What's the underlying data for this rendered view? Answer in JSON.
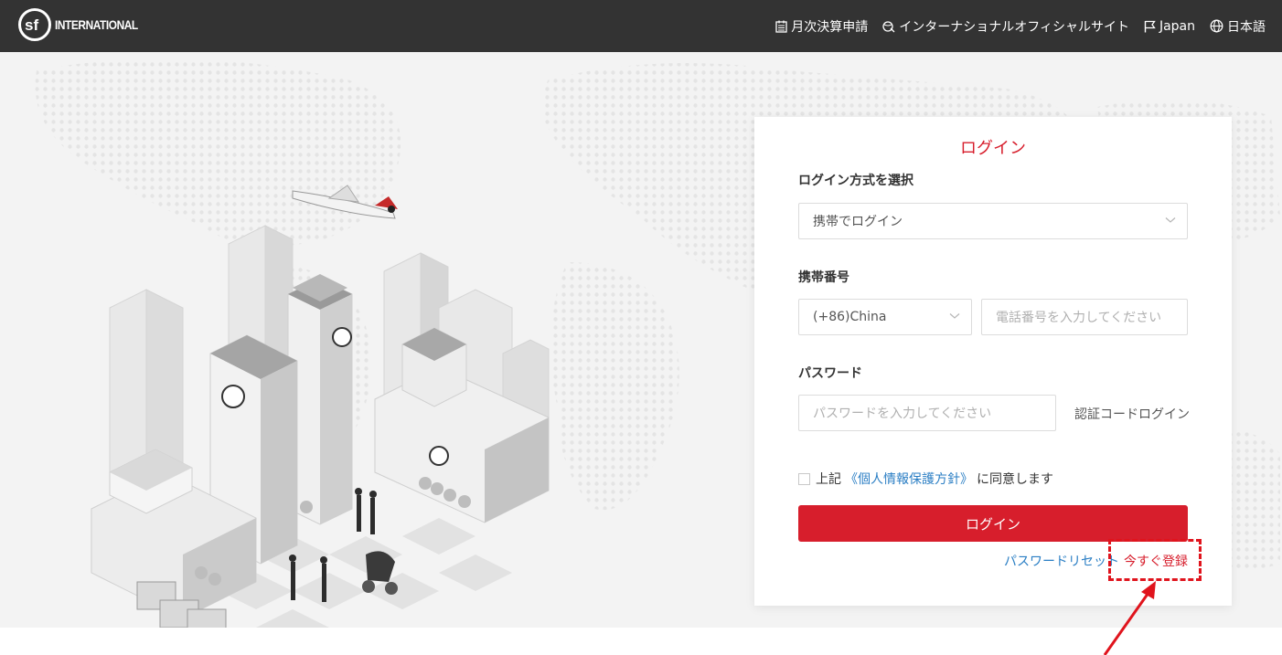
{
  "header": {
    "logo_text": "INTERNATIONAL",
    "nav": [
      {
        "label": "月次決算申請",
        "icon": "calendar-icon"
      },
      {
        "label": "インターナショナルオフィシャルサイト",
        "icon": "globe-link-icon"
      },
      {
        "label": "Japan",
        "icon": "flag-icon"
      },
      {
        "label": "日本語",
        "icon": "language-globe-icon"
      }
    ]
  },
  "login": {
    "title": "ログイン",
    "method_label": "ログイン方式を選択",
    "method_value": "携帯でログイン",
    "phone_label": "携帯番号",
    "country_code": "(+86)China",
    "phone_placeholder": "電話番号を入力してください",
    "password_label": "パスワード",
    "password_placeholder": "パスワードを入力してください",
    "code_login": "認証コードログイン",
    "agree_prefix": "上記",
    "agree_policy": "《個人情報保護方針》",
    "agree_suffix": "に同意します",
    "submit": "ログイン",
    "reset": "パスワードリセット",
    "register": "今すぐ登録"
  },
  "colors": {
    "header_bg": "#333333",
    "accent": "#d71e2c",
    "link": "#2a7ec4",
    "annotation": "#e0141d"
  }
}
